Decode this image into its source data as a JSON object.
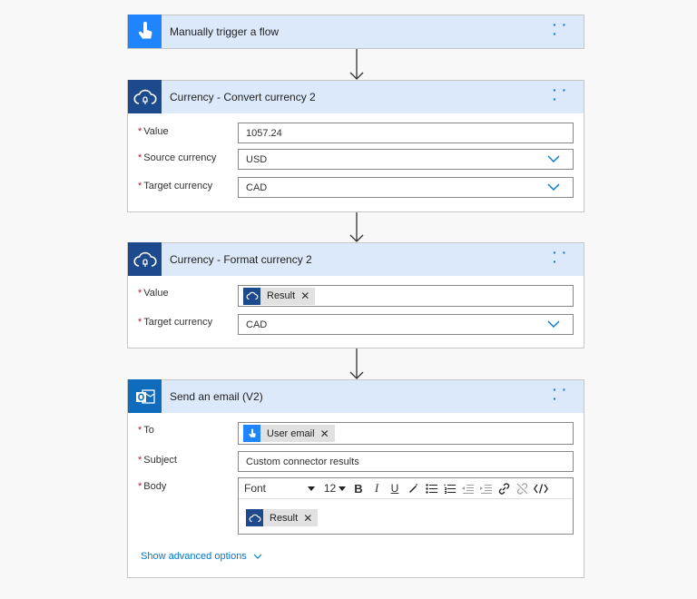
{
  "trigger": {
    "title": "Manually trigger a flow",
    "icon": "touch-icon",
    "color": "#1f85ff"
  },
  "convert": {
    "title": "Currency - Convert currency 2",
    "icon": "cloud-connector-icon",
    "fields": {
      "value": {
        "label": "Value",
        "value": "1057.24"
      },
      "source": {
        "label": "Source currency",
        "value": "USD"
      },
      "target": {
        "label": "Target currency",
        "value": "CAD"
      }
    }
  },
  "format": {
    "title": "Currency - Format currency 2",
    "icon": "cloud-connector-icon",
    "fields": {
      "value": {
        "label": "Value",
        "token": "Result"
      },
      "target": {
        "label": "Target currency",
        "value": "CAD"
      }
    }
  },
  "email": {
    "title": "Send an email (V2)",
    "icon": "outlook-icon",
    "fields": {
      "to": {
        "label": "To",
        "token": "User email"
      },
      "subject": {
        "label": "Subject",
        "value": "Custom connector results"
      },
      "body": {
        "label": "Body",
        "token": "Result"
      }
    },
    "toolbar": {
      "font": "Font",
      "size": "12"
    },
    "advanced_label": "Show advanced options"
  },
  "required_marker": "*",
  "colors": {
    "header_bg": "#dce9fb",
    "connector_blue": "#1c4a8c",
    "accent": "#0078d4"
  }
}
